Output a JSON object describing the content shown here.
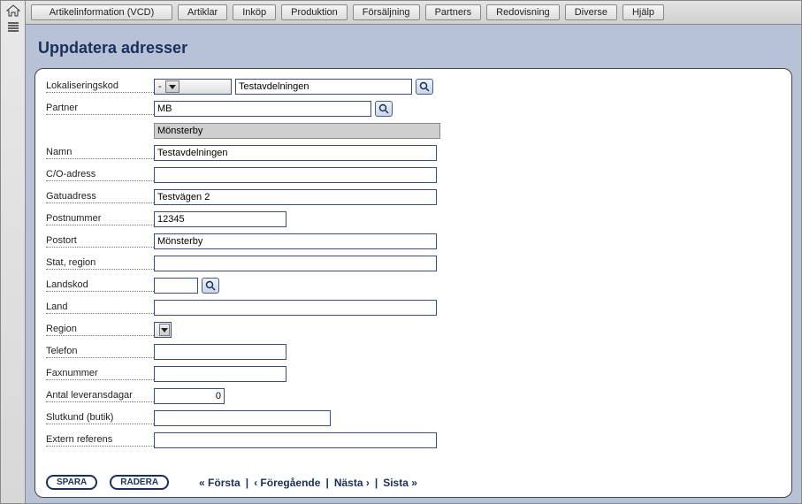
{
  "menu": {
    "items": [
      "Artikelinformation (VCD)",
      "Artiklar",
      "Inköp",
      "Produktion",
      "Försäljning",
      "Partners",
      "Redovisning",
      "Diverse",
      "Hjälp"
    ]
  },
  "page": {
    "title": "Uppdatera adresser"
  },
  "form": {
    "lokaliseringskod_label": "Lokaliseringskod",
    "lokaliseringskod_select": "-",
    "lokaliseringskod_text": "Testavdelningen",
    "partner_label": "Partner",
    "partner_value": "MB",
    "partner_resolved": "Mönsterby",
    "namn_label": "Namn",
    "namn_value": "Testavdelningen",
    "co_label": "C/O-adress",
    "co_value": "",
    "gatu_label": "Gatuadress",
    "gatu_value": "Testvägen 2",
    "postnr_label": "Postnummer",
    "postnr_value": "12345",
    "postort_label": "Postort",
    "postort_value": "Mönsterby",
    "stat_label": "Stat, region",
    "stat_value": "",
    "landskod_label": "Landskod",
    "landskod_value": "",
    "land_label": "Land",
    "land_value": "",
    "region_label": "Region",
    "region_value": "",
    "telefon_label": "Telefon",
    "telefon_value": "",
    "fax_label": "Faxnummer",
    "fax_value": "",
    "levdagar_label": "Antal leveransdagar",
    "levdagar_value": "0",
    "slutkund_label": "Slutkund (butik)",
    "slutkund_value": "",
    "extref_label": "Extern referens",
    "extref_value": ""
  },
  "footer": {
    "save": "SPARA",
    "delete": "RADERA",
    "first": "« Första",
    "prev": "‹ Föregående",
    "next": "Nästa ›",
    "last": "Sista »",
    "sep": "|"
  }
}
